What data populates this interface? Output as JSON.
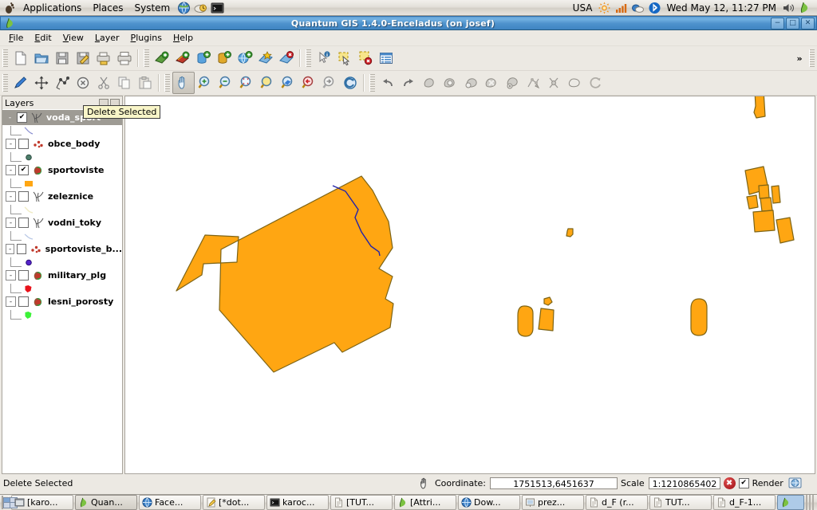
{
  "panel": {
    "menus": [
      "Applications",
      "Places",
      "System"
    ],
    "launchers": [
      "web-browser-icon",
      "update-manager-icon",
      "terminal-icon"
    ],
    "keyboard_layout": "USA",
    "tray": [
      "brightness-icon",
      "network-signal-icon",
      "network-manager-icon",
      "bluetooth-icon"
    ],
    "clock": "Wed May 12, 11:27 PM",
    "volume": "volume-icon",
    "app_tray_icon": "qgis-icon"
  },
  "window": {
    "title": "Quantum GIS 1.4.0-Enceladus (on josef)",
    "icon": "qgis-icon",
    "buttons": {
      "minimize": "−",
      "maximize": "□",
      "close": "✕"
    }
  },
  "menubar": [
    {
      "label": "File",
      "accel": "F"
    },
    {
      "label": "Edit",
      "accel": "E"
    },
    {
      "label": "View",
      "accel": "V"
    },
    {
      "label": "Layer",
      "accel": "L"
    },
    {
      "label": "Plugins",
      "accel": "P"
    },
    {
      "label": "Help",
      "accel": "H"
    }
  ],
  "toolbars": {
    "file": [
      "new-project-icon",
      "open-project-icon",
      "save-project-icon",
      "save-project-as-icon",
      "print-composer-icon",
      "print-icon"
    ],
    "layers": [
      "add-vector-layer-icon",
      "add-raster-layer-icon",
      "add-postgis-layer-icon",
      "add-spatialite-layer-icon",
      "add-wms-layer-icon",
      "new-vector-layer-icon",
      "remove-layer-icon"
    ],
    "attributes": [
      "identify-features-icon",
      "select-features-icon",
      "deselect-features-icon",
      "open-attribute-table-icon"
    ],
    "overflow_label": "»",
    "digitizing": [
      "toggle-editing-icon",
      "move-feature-icon",
      "node-tool-icon",
      "delete-selected-icon",
      "cut-features-icon",
      "copy-features-icon",
      "paste-features-icon"
    ],
    "map_navigation": [
      "pan-map-icon",
      "zoom-in-icon",
      "zoom-out-icon",
      "zoom-full-icon",
      "zoom-to-selection-icon",
      "zoom-to-layer-icon",
      "zoom-last-icon",
      "zoom-next-icon",
      "refresh-icon"
    ],
    "advanced_digitizing": [
      "undo-icon",
      "redo-icon",
      "simplify-feature-icon",
      "add-ring-icon",
      "add-part-icon",
      "delete-ring-icon",
      "delete-part-icon",
      "reshape-features-icon",
      "split-features-icon",
      "merge-features-icon",
      "rotate-point-symbols-icon"
    ],
    "active_tool": "pan-map-icon"
  },
  "tooltip": {
    "text": "Delete Selected"
  },
  "legend": {
    "title": "Layers",
    "header_buttons": [
      "collapse-all-button",
      "expand-all-button"
    ],
    "layers": [
      {
        "name": "voda_sport",
        "checked": true,
        "selected": true,
        "symbol": "line-symbol",
        "swatch": "#8a8fd0",
        "swatch_type": "line"
      },
      {
        "name": "obce_body",
        "checked": false,
        "selected": false,
        "symbol": "point-symbol",
        "swatch": "#4d7d6a",
        "swatch_type": "point"
      },
      {
        "name": "sportoviste",
        "checked": true,
        "selected": false,
        "symbol": "polygon-symbol",
        "swatch": "#ffa612",
        "swatch_type": "polygon"
      },
      {
        "name": "zeleznice",
        "checked": false,
        "selected": false,
        "symbol": "line-symbol",
        "swatch": "#f5f2d8",
        "swatch_type": "line"
      },
      {
        "name": "vodni_toky",
        "checked": false,
        "selected": false,
        "symbol": "line-symbol",
        "swatch": "#b9c8e6",
        "swatch_type": "line"
      },
      {
        "name": "sportoviste_b...",
        "checked": false,
        "selected": false,
        "symbol": "point-symbol",
        "swatch": "#5522cc",
        "swatch_type": "point"
      },
      {
        "name": "military_plg",
        "checked": false,
        "selected": false,
        "symbol": "polygon-symbol",
        "swatch": "#e8131b",
        "swatch_type": "polygon"
      },
      {
        "name": "lesni_porosty",
        "checked": false,
        "selected": false,
        "symbol": "polygon-symbol",
        "swatch": "#3cf238",
        "swatch_type": "polygon"
      }
    ]
  },
  "map": {
    "background": "#ffffff",
    "polygon_fill": "#ffa612",
    "polygon_stroke": "#806611",
    "line_color": "#2222aa"
  },
  "statusbar": {
    "message": "Delete Selected",
    "coordinate_label": "Coordinate:",
    "coordinate_value": "1751513,6451637",
    "scale_label": "Scale",
    "scale_value": "1:1210865402",
    "stop_label": "✖",
    "render_label": "Render",
    "render_checked": true,
    "projection_icon": "projection-status-icon",
    "mouse_icon": "mouse-position-icon"
  },
  "taskbar": {
    "workspace_switcher": "workspace-switcher",
    "tasks": [
      {
        "label": "[karo...",
        "icon": "window-icon",
        "active": false
      },
      {
        "label": "Quan...",
        "icon": "qgis-icon",
        "active": true
      },
      {
        "label": "Face...",
        "icon": "browser-icon",
        "active": false
      },
      {
        "label": "[*dot...",
        "icon": "editor-icon",
        "active": false
      },
      {
        "label": "karoc...",
        "icon": "terminal-icon",
        "active": false
      },
      {
        "label": "[TUT...",
        "icon": "doc-icon",
        "active": false
      },
      {
        "label": "[Attri...",
        "icon": "qgis-icon",
        "active": false
      },
      {
        "label": "Dow...",
        "icon": "browser-icon",
        "active": false
      },
      {
        "label": "prez...",
        "icon": "present-icon",
        "active": false
      },
      {
        "label": "d_F (r...",
        "icon": "doc-icon",
        "active": false
      },
      {
        "label": "TUT...",
        "icon": "doc-icon",
        "active": false
      },
      {
        "label": "d_F-1...",
        "icon": "doc-icon",
        "active": false
      }
    ],
    "tray_app_icon": "qgis-icon"
  }
}
